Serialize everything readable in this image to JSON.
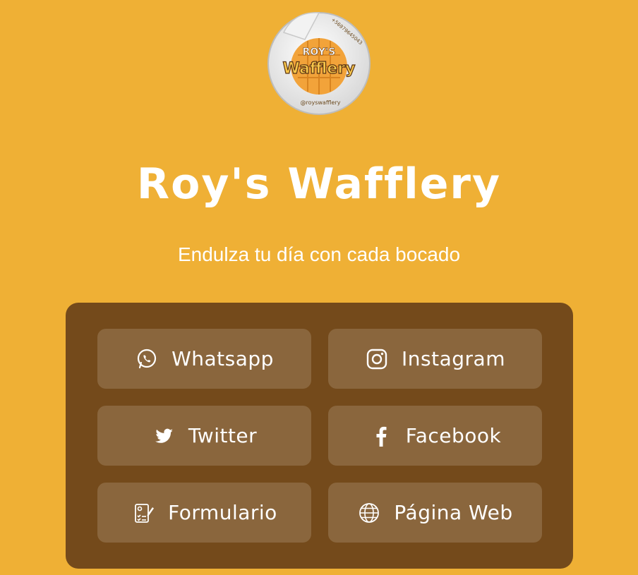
{
  "brand": {
    "title": "Roy's Wafflery",
    "subtitle": "Endulza tu día con cada bocado",
    "logo_text_top": "ROY'S",
    "logo_text_main": "Wafflery",
    "logo_phone": "+56979645043",
    "logo_handle": "@royswafflery"
  },
  "links": [
    {
      "label": "Whatsapp",
      "icon": "whatsapp-icon"
    },
    {
      "label": "Instagram",
      "icon": "instagram-icon"
    },
    {
      "label": "Twitter",
      "icon": "twitter-icon"
    },
    {
      "label": "Facebook",
      "icon": "facebook-icon"
    },
    {
      "label": "Formulario",
      "icon": "form-icon"
    },
    {
      "label": "Página Web",
      "icon": "globe-icon"
    }
  ],
  "colors": {
    "background": "#EFB035",
    "panel": "#744A1B",
    "button": "#8A663D",
    "text": "#FFFFFF"
  }
}
